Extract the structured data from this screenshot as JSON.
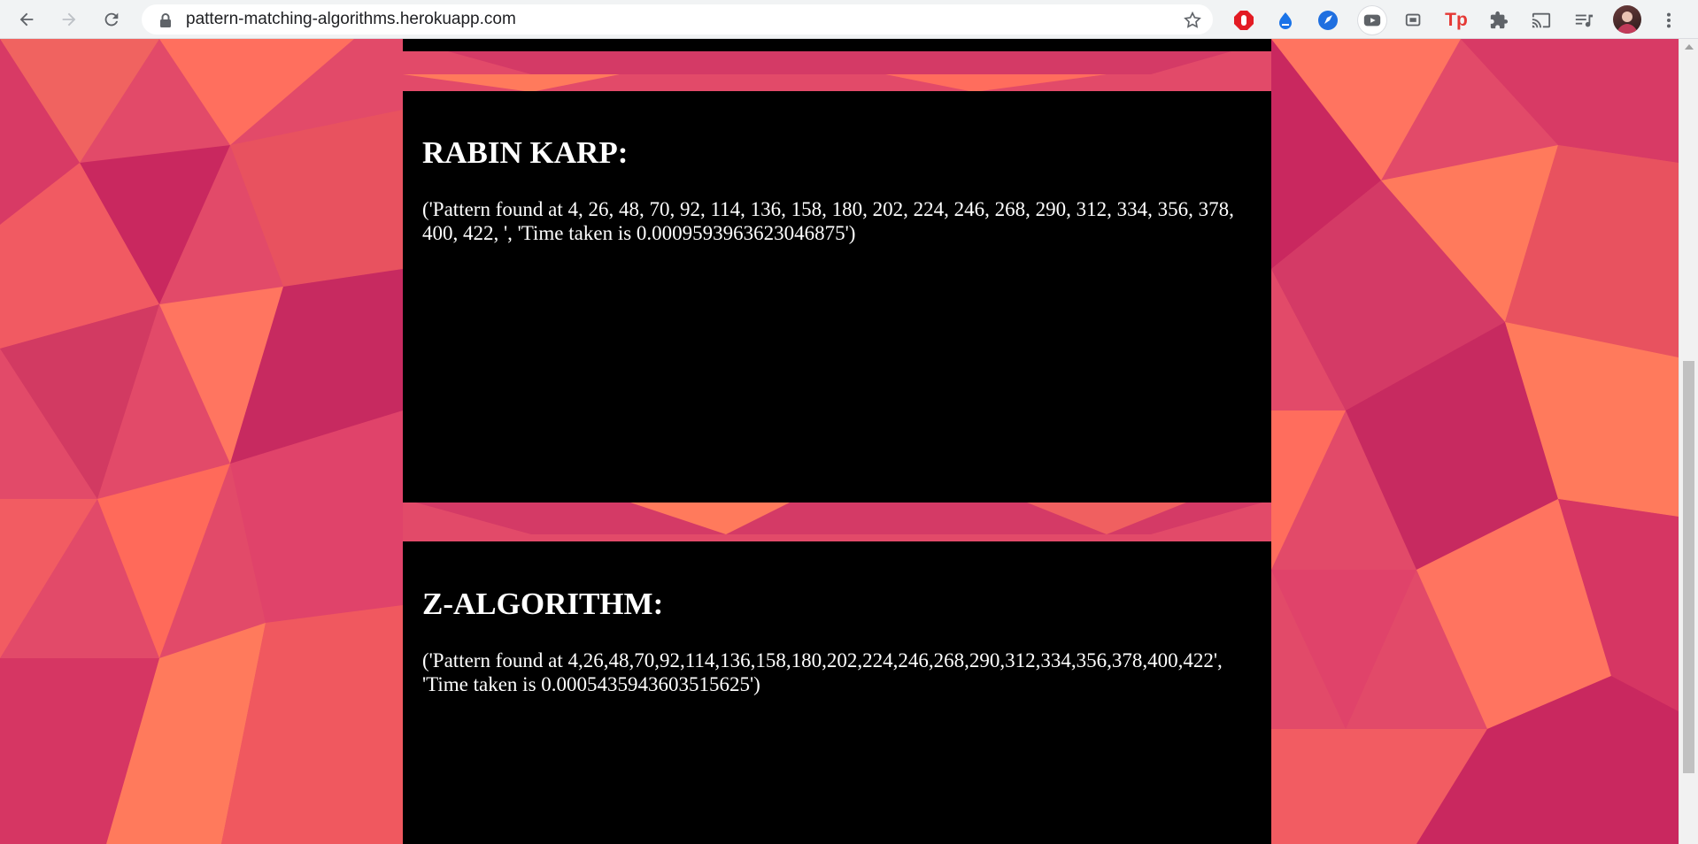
{
  "browser": {
    "url": "pattern-matching-algorithms.herokuapp.com",
    "extensions": [
      "adblock-icon",
      "cloud-extension-icon",
      "rocket-extension-icon",
      "video-extension-icon",
      "screen-extension-icon",
      "tp-extension-icon",
      "puzzle-icon",
      "cast-icon",
      "reading-list-icon",
      "avatar",
      "menu-icon"
    ],
    "tp_label": "Tp"
  },
  "sections": {
    "rabin_karp": {
      "title": "RABIN KARP:",
      "result": "('Pattern found at 4, 26, 48, 70, 92, 114, 136, 158, 180, 202, 224, 246, 268, 290, 312, 334, 356, 378, 400, 422, ', 'Time taken is 0.0009593963623046875')"
    },
    "z_algorithm": {
      "title": "Z-ALGORITHM:",
      "result": "('Pattern found at 4,26,48,70,92,114,136,158,180,202,224,246,268,290,312,334,356,378,400,422', 'Time taken is 0.0005435943603515625')"
    }
  },
  "colors": {
    "card_bg": "#000000",
    "bg_primary": "#e34a6a",
    "bg_secondary": "#ff7a5c",
    "bg_tertiary": "#c9285f"
  }
}
